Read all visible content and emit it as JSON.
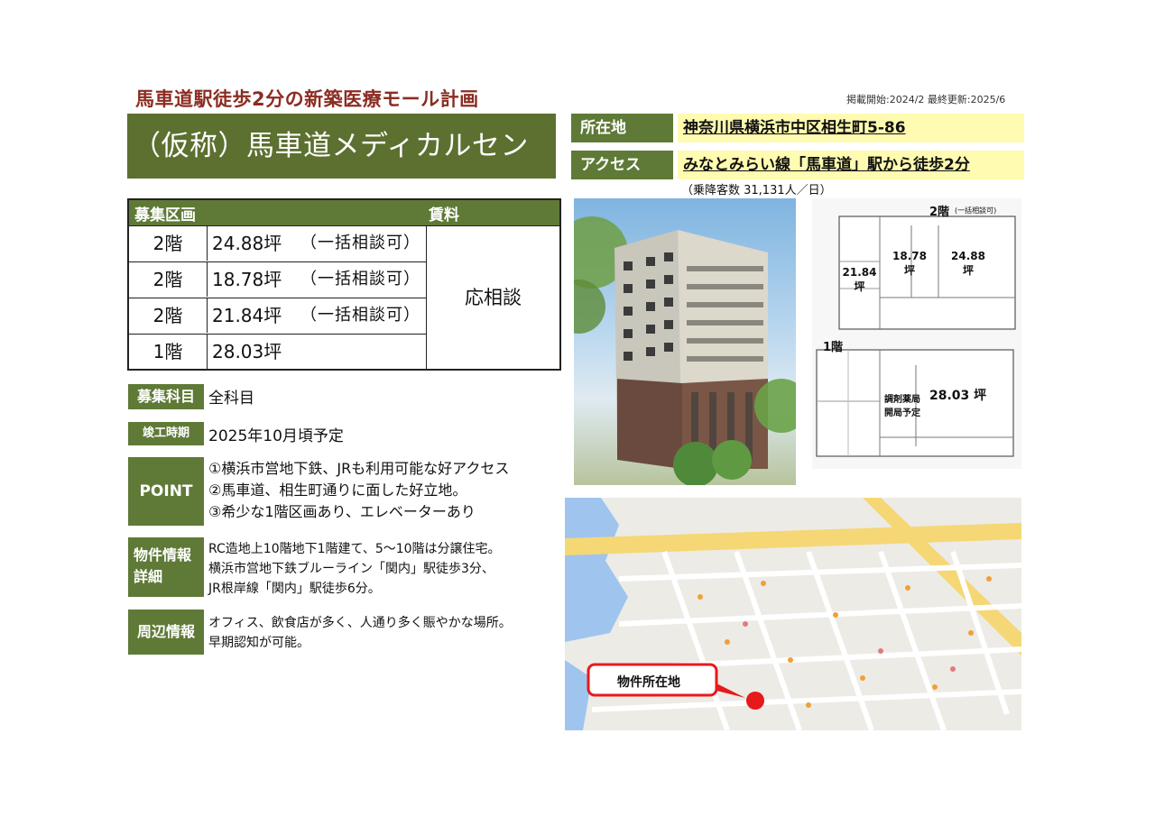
{
  "header": {
    "headline": "馬車道駅徒歩2分の新築医療モール計画",
    "dates": "掲載開始:2024/2  最終更新:2025/6",
    "title": "（仮称）馬車道メディカルセンター"
  },
  "location": {
    "label": "所在地",
    "value": "神奈川県横浜市中区相生町5-86"
  },
  "access": {
    "label": "アクセス",
    "value": "みなとみらい線「馬車道」駅から徒歩2分",
    "riders": "（乗降客数 31,131人／日）"
  },
  "recruit_table": {
    "header_section": "募集区画",
    "header_rent": "賃料",
    "rows": [
      {
        "floor": "2階",
        "area": "24.88坪",
        "note": "（一括相談可）"
      },
      {
        "floor": "2階",
        "area": "18.78坪",
        "note": "（一括相談可）"
      },
      {
        "floor": "2階",
        "area": "21.84坪",
        "note": "（一括相談可）"
      },
      {
        "floor": "1階",
        "area": "28.03坪",
        "note": ""
      }
    ],
    "rent": "応相談"
  },
  "subjects": {
    "label": "募集科目",
    "value": "全科目"
  },
  "completion": {
    "label": "竣工時期",
    "value": "2025年10月頃予定"
  },
  "point": {
    "label": "POINT",
    "items": [
      "①横浜市営地下鉄、JRも利用可能な好アクセス",
      "②馬車道、相生町通りに面した好立地。",
      "③希少な1階区画あり、エレベーターあり"
    ]
  },
  "property_info": {
    "label_line1": "物件情報",
    "label_line2": "詳細",
    "lines": [
      "RC造地上10階地下1階建て、5～10階は分譲住宅。",
      "横浜市営地下鉄ブルーライン「関内」駅徒歩3分、",
      "JR根岸線「関内」駅徒歩6分。"
    ]
  },
  "surroundings": {
    "label": "周辺情報",
    "lines": [
      "オフィス、飲食店が多く、人通り多く賑やかな場所。",
      "早期認知が可能。"
    ]
  },
  "floorplan": {
    "floor2_label": "2階",
    "floor2_note": "(一括相談可)",
    "units_2f": [
      {
        "area": "21.84",
        "unit": "坪"
      },
      {
        "area": "18.78",
        "unit": "坪"
      },
      {
        "area": "24.88",
        "unit": "坪"
      }
    ],
    "floor1_label": "1階",
    "pharmacy_line1": "調剤薬局",
    "pharmacy_line2": "開局予定",
    "unit_1f": "28.03 坪"
  },
  "map": {
    "callout": "物件所在地"
  },
  "colors": {
    "green": "#5f7a37",
    "title_green": "#5c7030",
    "headline_red": "#8b2c22",
    "highlight": "#fffbb0",
    "pin_red": "#e8191a"
  }
}
